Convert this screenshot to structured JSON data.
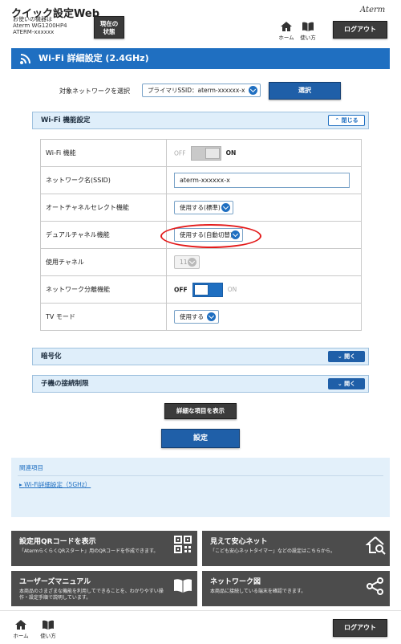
{
  "header": {
    "app_title": "クイック設定Web",
    "device_line1": "お使いの機器は",
    "device_line2": "Aterm WG1200HP4",
    "device_line3": "ATERM-xxxxxx",
    "status_label_1": "現在の",
    "status_label_2": "状態",
    "home_label": "ホーム",
    "help_label": "使い方",
    "logout_label": "ログアウト",
    "brand": "Aterm"
  },
  "page": {
    "title": "Wi-Fi 詳細設定 (2.4GHz)",
    "target_label": "対象ネットワークを選択",
    "target_value": "プライマリSSID：aterm-xxxxxx-x",
    "select_button": "選択"
  },
  "wifi_section": {
    "header": "Wi-Fi 機能設定",
    "toggle_label": "閉じる",
    "rows": [
      {
        "label": "Wi-Fi 機能",
        "off": "OFF",
        "on": "ON",
        "state": "on"
      },
      {
        "label": "ネットワーク名(SSID)",
        "value": "aterm-xxxxxx-x"
      },
      {
        "label": "オートチャネルセレクト機能",
        "value": "使用する(標準)"
      },
      {
        "label": "デュアルチャネル機能",
        "value": "使用する(自動切替)"
      },
      {
        "label": "使用チャネル",
        "value": "11"
      },
      {
        "label": "ネットワーク分離機能",
        "off": "OFF",
        "on": "ON",
        "state": "off"
      },
      {
        "label": "TV モード",
        "value": "使用する"
      }
    ]
  },
  "encryption_section": {
    "header": "暗号化",
    "toggle_label": "開く"
  },
  "client_section": {
    "header": "子機の接続制限",
    "toggle_label": "開く"
  },
  "buttons": {
    "show_details": "詳細な項目を表示",
    "apply": "設定"
  },
  "related": {
    "title": "関連項目",
    "link": "Wi-Fi詳細設定（5GHz）"
  },
  "tiles": [
    {
      "title": "設定用QRコードを表示",
      "desc": "「AtermらくらくQRスタート」用のQRコードを作成できます。",
      "icon": "qr-code-icon"
    },
    {
      "title": "見えて安心ネット",
      "desc": "「こども安心ネットタイマー」などの設定はこちらから。",
      "icon": "home-search-icon"
    },
    {
      "title": "ユーザーズマニュアル",
      "desc": "本商品のさまざまな機能を利用してできることを、わかりやすい操作・設定手順で説明しています。",
      "icon": "book-icon"
    },
    {
      "title": "ネットワーク図",
      "desc": "本商品に接続している端末を確認できます。",
      "icon": "share-icon"
    }
  ],
  "footer": {
    "home_label": "ホーム",
    "help_label": "使い方",
    "logout_label": "ログアウト"
  },
  "colors": {
    "accent_blue": "#1f6fc1",
    "dark_button": "#3b3b3b",
    "panel_bg": "#e3f0fa",
    "highlight_red": "#e31b1b"
  }
}
